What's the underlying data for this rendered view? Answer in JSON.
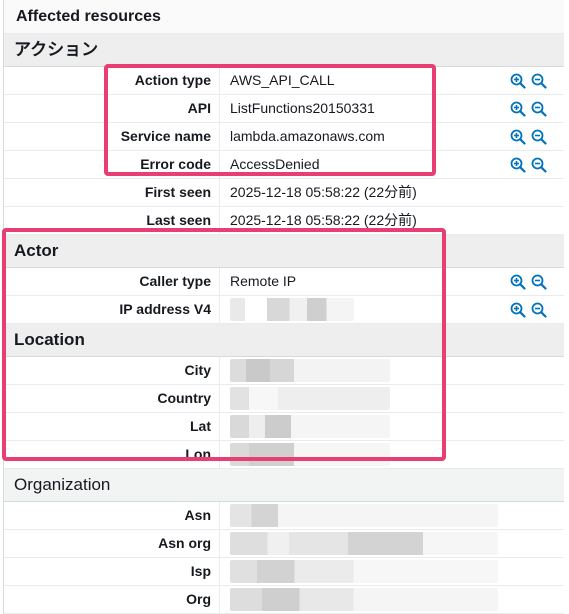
{
  "header": {
    "title": "Affected resources"
  },
  "action": {
    "title": "アクション",
    "rows": [
      {
        "label": "Action type",
        "value": "AWS_API_CALL"
      },
      {
        "label": "API",
        "value": "ListFunctions20150331"
      },
      {
        "label": "Service name",
        "value": "lambda.amazonaws.com"
      },
      {
        "label": "Error code",
        "value": "AccessDenied"
      },
      {
        "label": "First seen",
        "value": "2025-12-18 05:58:22 (22分前)"
      },
      {
        "label": "Last seen",
        "value": "2025-12-18 05:58:22 (22分前)"
      }
    ]
  },
  "actor": {
    "title": "Actor",
    "rows": [
      {
        "label": "Caller type",
        "value": "Remote IP"
      },
      {
        "label": "IP address V4",
        "value": ""
      }
    ]
  },
  "location": {
    "title": "Location",
    "rows": [
      {
        "label": "City"
      },
      {
        "label": "Country"
      },
      {
        "label": "Lat"
      },
      {
        "label": "Lon"
      }
    ]
  },
  "organization": {
    "title": "Organization",
    "rows": [
      {
        "label": "Asn"
      },
      {
        "label": "Asn org"
      },
      {
        "label": "Isp"
      },
      {
        "label": "Org"
      }
    ]
  },
  "icons": {
    "zoom_in": "zoom-in-icon",
    "zoom_out": "zoom-out-icon"
  },
  "colors": {
    "highlight": "#e83e74",
    "icon": "#0073bb",
    "section_bg": "#eeeeee"
  }
}
